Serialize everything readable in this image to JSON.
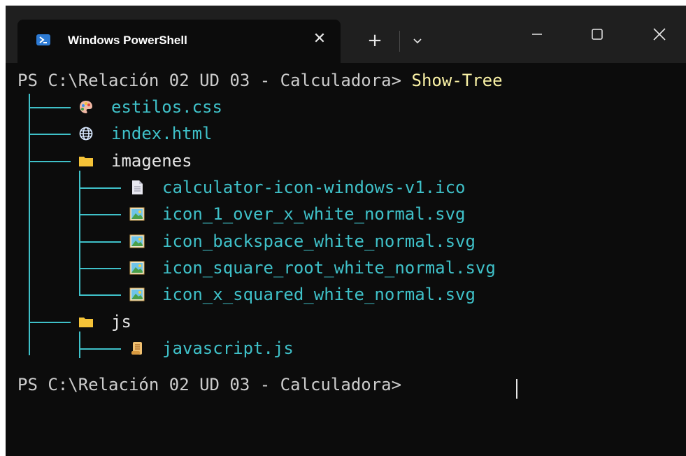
{
  "tab": {
    "title": "Windows PowerShell",
    "close_glyph": "✕",
    "new_tab_glyph": "+"
  },
  "colors": {
    "terminal_bg": "#0c0c0c",
    "titlebar_bg": "#1f1f1f",
    "tree_line": "#3fc1c9",
    "command": "#f9f1a5",
    "file_text": "#3fc1c9",
    "dir_text": "#e6e6e6"
  },
  "terminal": {
    "prompt": "PS C:\\Relación 02 UD 03 - Calculadora> ",
    "command": "Show-Tree",
    "prompt_end": "PS C:\\Relación 02 UD 03 - Calculadora> "
  },
  "tree": [
    {
      "name": "estilos.css",
      "icon": "palette-icon",
      "depth": 0,
      "type": "file"
    },
    {
      "name": "index.html",
      "icon": "globe-icon",
      "depth": 0,
      "type": "file"
    },
    {
      "name": "imagenes",
      "icon": "folder-icon",
      "depth": 0,
      "type": "dir"
    },
    {
      "name": "calculator-icon-windows-v1.ico",
      "icon": "document-icon",
      "depth": 1,
      "type": "file"
    },
    {
      "name": "icon_1_over_x_white_normal.svg",
      "icon": "image-icon",
      "depth": 1,
      "type": "file"
    },
    {
      "name": "icon_backspace_white_normal.svg",
      "icon": "image-icon",
      "depth": 1,
      "type": "file"
    },
    {
      "name": "icon_square_root_white_normal.svg",
      "icon": "image-icon",
      "depth": 1,
      "type": "file"
    },
    {
      "name": "icon_x_squared_white_normal.svg",
      "icon": "image-icon",
      "depth": 1,
      "type": "file"
    },
    {
      "name": "js",
      "icon": "folder-icon",
      "depth": 0,
      "type": "dir"
    },
    {
      "name": "javascript.js",
      "icon": "scroll-icon",
      "depth": 1,
      "type": "file"
    }
  ]
}
